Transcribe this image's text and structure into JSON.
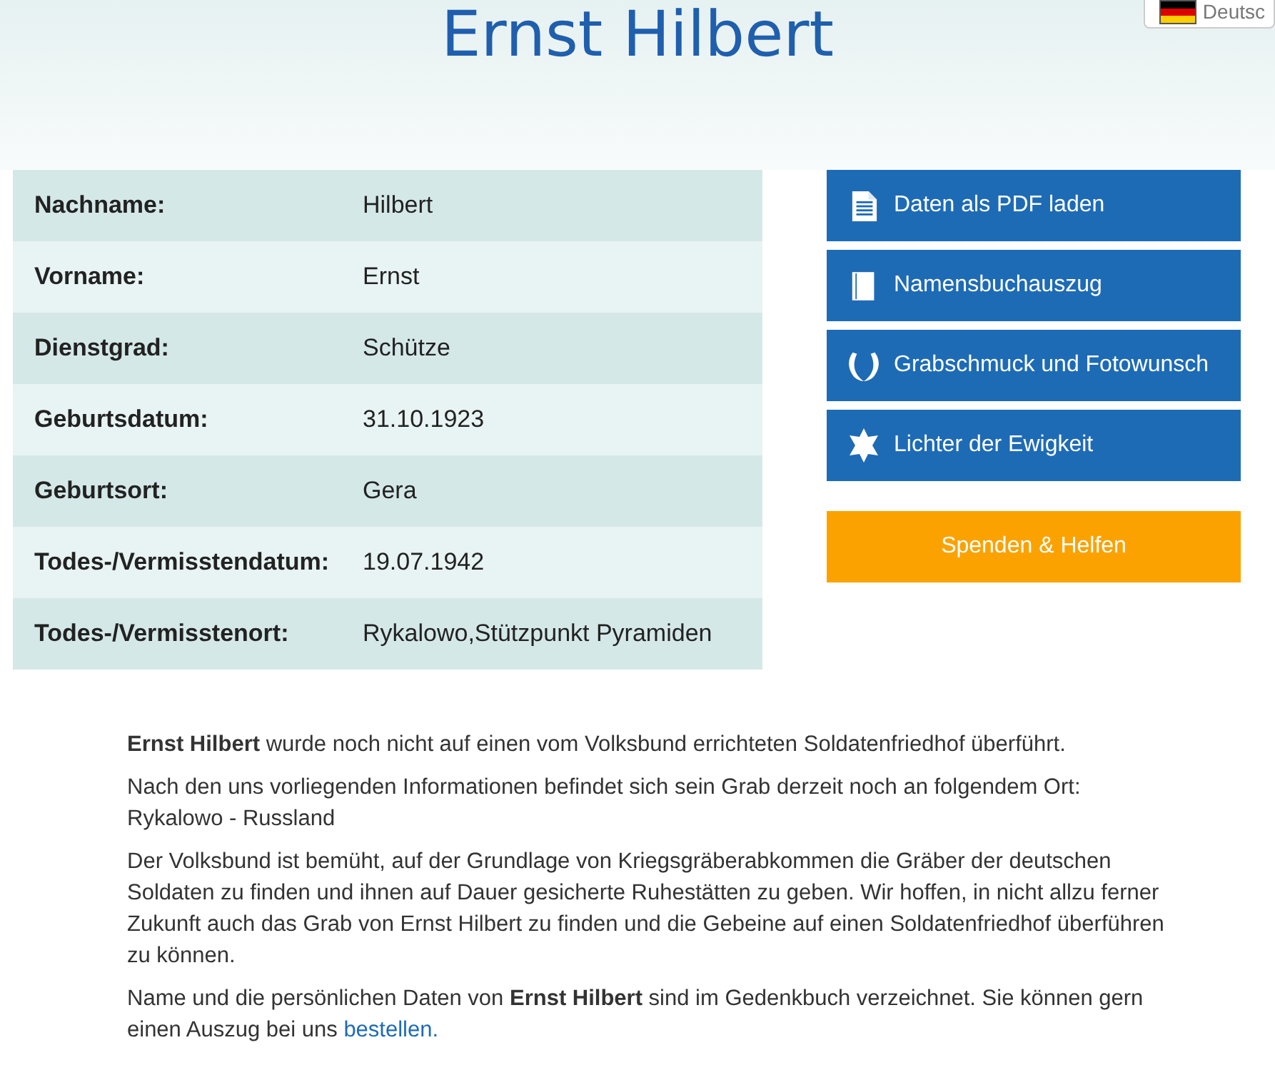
{
  "language": {
    "label": "Deutsc"
  },
  "title": "Ernst Hilbert",
  "details": [
    {
      "label": "Nachname:",
      "value": "Hilbert"
    },
    {
      "label": "Vorname:",
      "value": "Ernst"
    },
    {
      "label": "Dienstgrad:",
      "value": "Schütze"
    },
    {
      "label": "Geburtsdatum:",
      "value": "31.10.1923"
    },
    {
      "label": "Geburtsort:",
      "value": "Gera"
    },
    {
      "label": "Todes-/Vermisstendatum:",
      "value": "19.07.1942"
    },
    {
      "label": "Todes-/Vermisstenort:",
      "value": "Rykalowo,Stützpunkt Pyramiden"
    }
  ],
  "actions": [
    {
      "kind": "document",
      "label": "Daten als PDF laden"
    },
    {
      "kind": "book",
      "label": "Namensbuchauszug"
    },
    {
      "kind": "wreath",
      "label": "Grabschmuck und Fotowunsch"
    },
    {
      "kind": "star",
      "label": "Lichter der Ewigkeit"
    }
  ],
  "donate": {
    "label": "Spenden & Helfen"
  },
  "paragraphs": [
    {
      "text": "**Ernst Hilbert** wurde noch nicht auf einen vom Volksbund errichteten Soldatenfriedhof überführt."
    },
    {
      "text": "Nach den uns vorliegenden Informationen befindet sich sein Grab derzeit noch an folgendem Ort: Rykalowo - Russland"
    },
    {
      "text": "Der Volksbund ist bemüht, auf der Grundlage von Kriegsgräberabkommen die Gräber der deutschen Soldaten zu finden und ihnen auf Dauer gesicherte Ruhestätten zu geben. Wir hoffen, in nicht allzu ferner Zukunft auch das Grab von Ernst Hilbert zu finden und die Gebeine auf einen Soldatenfriedhof überführen zu können."
    },
    {
      "text": "Name und die persönlichen Daten von **Ernst Hilbert** sind im Gedenkbuch verzeichnet. Sie können gern einen Auszug bei uns",
      "link": "bestellen."
    }
  ]
}
